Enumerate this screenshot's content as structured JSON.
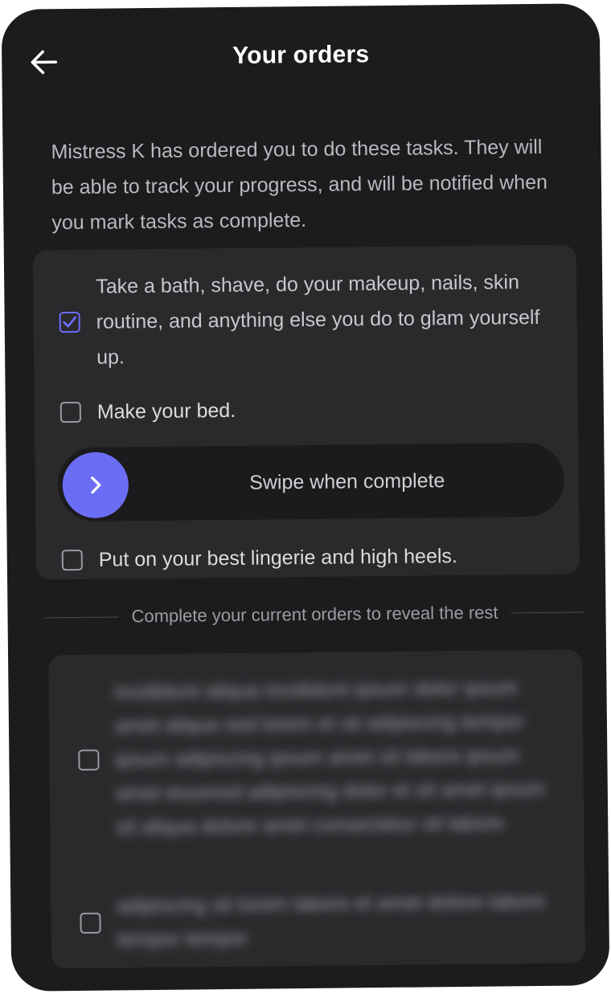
{
  "header": {
    "title": "Your orders",
    "back_icon": "arrow-left-icon"
  },
  "intro": "Mistress K has ordered you to do these tasks. They will be able to track your progress, and will be notified when you mark tasks as complete.",
  "tasks": [
    {
      "text": "Take a bath, shave, do your makeup, nails, skin routine, and anything else you do to glam yourself up.",
      "checked": true
    },
    {
      "text": "Make your bed.",
      "checked": false
    },
    {
      "text": "Put on your best lingerie and high heels.",
      "checked": false
    }
  ],
  "swipe": {
    "label": "Swipe when complete",
    "icon": "chevron-right-icon"
  },
  "divider": {
    "text": "Complete your current orders to reveal the rest"
  },
  "colors": {
    "accent": "#6b6ef5",
    "background": "#1c1c1e",
    "card": "#2a2a2d"
  }
}
